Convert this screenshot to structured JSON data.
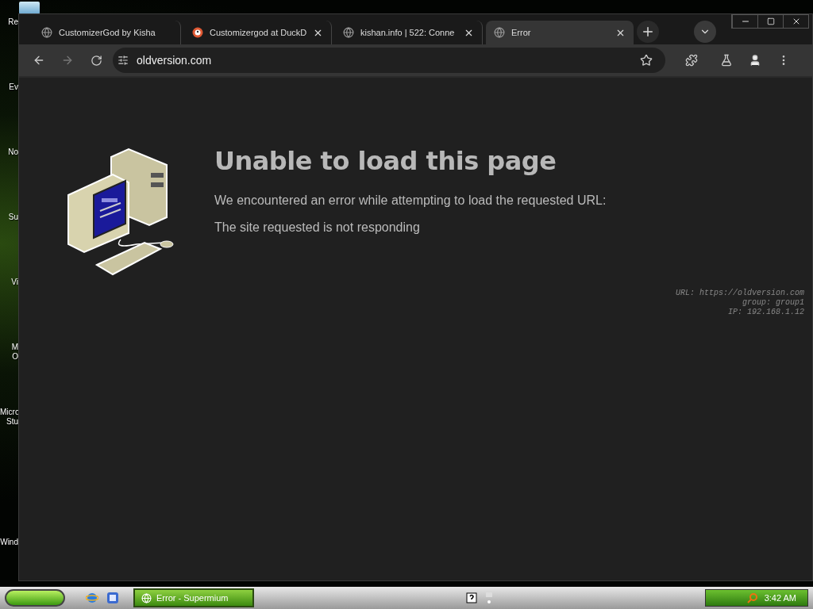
{
  "desktop_icons": [
    {
      "lines": [
        "Re"
      ]
    },
    {
      "lines": [
        "Ev"
      ]
    },
    {
      "lines": [
        "No"
      ]
    },
    {
      "lines": [
        "Su"
      ]
    },
    {
      "lines": [
        "Vi"
      ]
    },
    {
      "lines": [
        "M",
        "O"
      ]
    },
    {
      "lines": [
        "Micro",
        "Stu"
      ]
    },
    {
      "lines": [
        "Wind"
      ]
    }
  ],
  "tabs": [
    {
      "title": "CustomizerGod by Kisha",
      "kind": "globe",
      "selected": false,
      "closable": false
    },
    {
      "title": "Customizergod at DuckD",
      "kind": "duck",
      "selected": false,
      "closable": true
    },
    {
      "title": "kishan.info | 522: Conne",
      "kind": "globe",
      "selected": false,
      "closable": true
    },
    {
      "title": "Error",
      "kind": "globe",
      "selected": true,
      "closable": true
    }
  ],
  "address_bar": {
    "value": "oldversion.com"
  },
  "error_page": {
    "title": "Unable to load this page",
    "message": "We encountered an error while attempting to load the requested URL:",
    "reason": "The site requested is not responding",
    "details": [
      "URL: https://oldversion.com",
      "group: group1",
      "IP: 192.168.1.12"
    ]
  },
  "taskbar": {
    "task": {
      "label": "Error - Supermium",
      "selected": true
    },
    "clock": "3:42 AM"
  }
}
